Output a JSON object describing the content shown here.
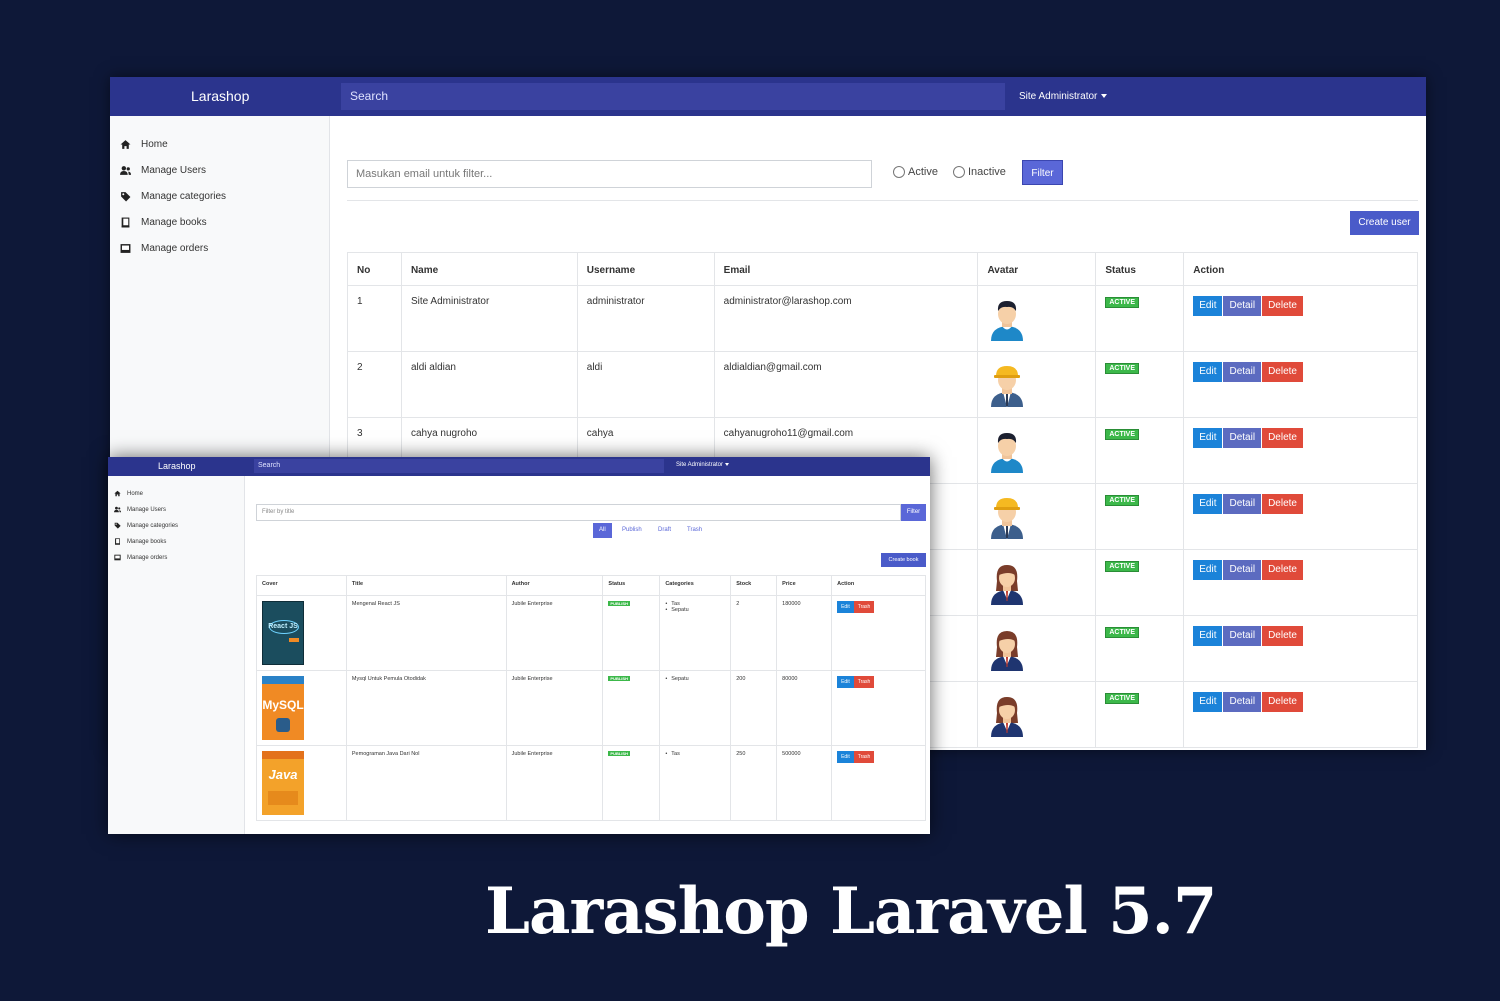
{
  "headline": "Larashop Laravel 5.7",
  "users_window": {
    "brand": "Larashop",
    "search_placeholder": "Search",
    "user_menu": "Site Administrator",
    "sidebar": [
      {
        "label": "Home",
        "icon": "home-icon"
      },
      {
        "label": "Manage Users",
        "icon": "users-icon"
      },
      {
        "label": "Manage categories",
        "icon": "tag-icon"
      },
      {
        "label": "Manage books",
        "icon": "book-icon"
      },
      {
        "label": "Manage orders",
        "icon": "inbox-icon"
      }
    ],
    "filter_placeholder": "Masukan email untuk filter...",
    "radio_active": "Active",
    "radio_inactive": "Inactive",
    "filter_button": "Filter",
    "create_button": "Create user",
    "columns": [
      "No",
      "Name",
      "Username",
      "Email",
      "Avatar",
      "Status",
      "Action"
    ],
    "rows": [
      {
        "no": "1",
        "name": "Site Administrator",
        "username": "administrator",
        "email": "administrator@larashop.com",
        "status": "ACTIVE",
        "avatar": "male-user"
      },
      {
        "no": "2",
        "name": "aldi aldian",
        "username": "aldi",
        "email": "aldialdian@gmail.com",
        "status": "ACTIVE",
        "avatar": "worker"
      },
      {
        "no": "3",
        "name": "cahya nugroho",
        "username": "cahya",
        "email": "cahyanugroho11@gmail.com",
        "status": "ACTIVE",
        "avatar": "male-user"
      },
      {
        "no": "",
        "name": "",
        "username": "",
        "email": "",
        "status": "ACTIVE",
        "avatar": "worker"
      },
      {
        "no": "",
        "name": "",
        "username": "",
        "email": "",
        "status": "ACTIVE",
        "avatar": "female-user"
      },
      {
        "no": "",
        "name": "",
        "username": "",
        "email": "",
        "status": "ACTIVE",
        "avatar": "female-user"
      },
      {
        "no": "",
        "name": "",
        "username": "",
        "email": "",
        "status": "ACTIVE",
        "avatar": "female-user"
      }
    ],
    "actions": {
      "edit": "Edit",
      "detail": "Detail",
      "delete": "Delete"
    },
    "colors": {
      "navbar": "#2b348d",
      "primary": "#5a67d8",
      "edit": "#1b83d9",
      "delete": "#e04a3a",
      "active": "#3cb84a"
    }
  },
  "books_window": {
    "brand": "Larashop",
    "search_placeholder": "Search",
    "user_menu": "Site Administrator",
    "sidebar": [
      {
        "label": "Home",
        "icon": "home-icon"
      },
      {
        "label": "Manage Users",
        "icon": "users-icon"
      },
      {
        "label": "Manage categories",
        "icon": "tag-icon"
      },
      {
        "label": "Manage books",
        "icon": "book-icon"
      },
      {
        "label": "Manage orders",
        "icon": "inbox-icon"
      }
    ],
    "filter_placeholder": "Filter by title",
    "filter_button": "Filter",
    "tabs": [
      "All",
      "Publish",
      "Draft",
      "Trash"
    ],
    "active_tab": "All",
    "create_button": "Create book",
    "columns": [
      "Cover",
      "Title",
      "Author",
      "Status",
      "Categories",
      "Stock",
      "Price",
      "Action"
    ],
    "rows": [
      {
        "cover": "React JS",
        "title": "Mengenal React JS",
        "author": "Jubile Enterprise",
        "status": "PUBLISH",
        "categories": [
          "Tas",
          "Sepatu"
        ],
        "stock": "2",
        "price": "180000"
      },
      {
        "cover": "MySQL",
        "title": "Mysql Untuk Pemula Otodidak",
        "author": "Jubile Enterprise",
        "status": "PUBLISH",
        "categories": [
          "Sepatu"
        ],
        "stock": "200",
        "price": "80000"
      },
      {
        "cover": "Java",
        "title": "Pemograman Java Dari Nol",
        "author": "Jubile Enterprise",
        "status": "PUBLISH",
        "categories": [
          "Tas"
        ],
        "stock": "250",
        "price": "500000"
      }
    ],
    "actions": {
      "edit": "Edit",
      "trash": "Trash"
    }
  }
}
